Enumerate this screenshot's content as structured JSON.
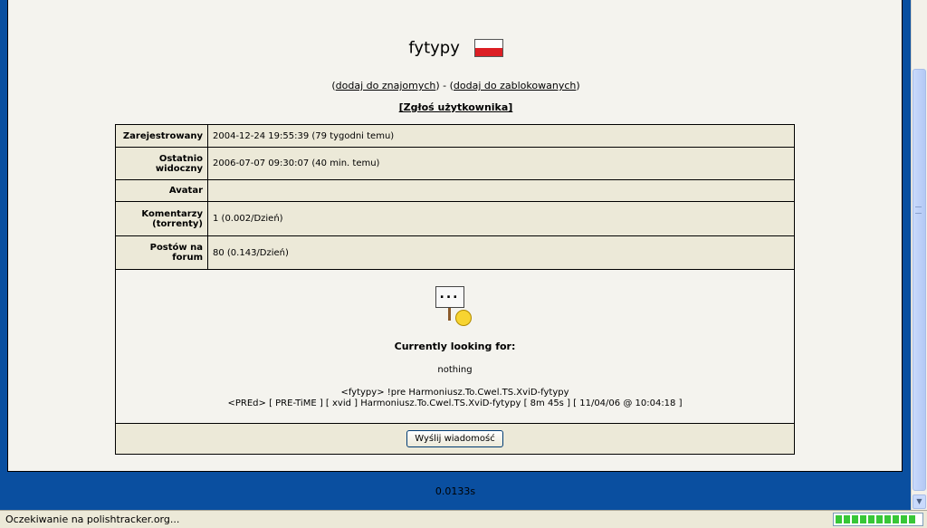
{
  "profile": {
    "username": "fytypy",
    "flag_country": "Poland"
  },
  "links": {
    "open1": "(",
    "add_friend": "dodaj do znajomych",
    "close1": ")",
    "sep": " - ",
    "open2": "(",
    "add_blocked": "dodaj do zablokowanych",
    "close2": ")",
    "report": "[Zgłoś użytkownika]"
  },
  "info_rows": [
    {
      "label": "Zarejestrowany",
      "value": "2004-12-24 19:55:39 (79 tygodni temu)"
    },
    {
      "label": "Ostatnio widoczny",
      "value": "2006-07-07 09:30:07 (40 min. temu)"
    },
    {
      "label": "Avatar",
      "value": ""
    },
    {
      "label": "Komentarzy (torrenty)",
      "value": "1 (0.002/Dzień)"
    },
    {
      "label": "Postów na forum",
      "value": "80 (0.143/Dzień)"
    }
  ],
  "signature": {
    "sign_text": "...",
    "looking_title": "Currently looking for:",
    "looking_value": "nothing",
    "line1": "<fytypy> !pre Harmoniusz.To.Cwel.TS.XviD-fytypy",
    "line2": "<PREd> [ PRE-TiME ] [ xvid ] Harmoniusz.To.Cwel.TS.XviD-fytypy [ 8m 45s ] [ 11/04/06 @ 10:04:18 ]"
  },
  "send_button": "Wyślij wiadomość",
  "render_time": "0.0133s",
  "status": {
    "text": "Oczekiwanie na polishtracker.org...",
    "progress_fraction": 0.9
  },
  "colors": {
    "page_bg": "#0a4fa0",
    "panel_bg": "#f4f3ee",
    "table_bg": "#ece9d8",
    "progress": "#37c737"
  }
}
